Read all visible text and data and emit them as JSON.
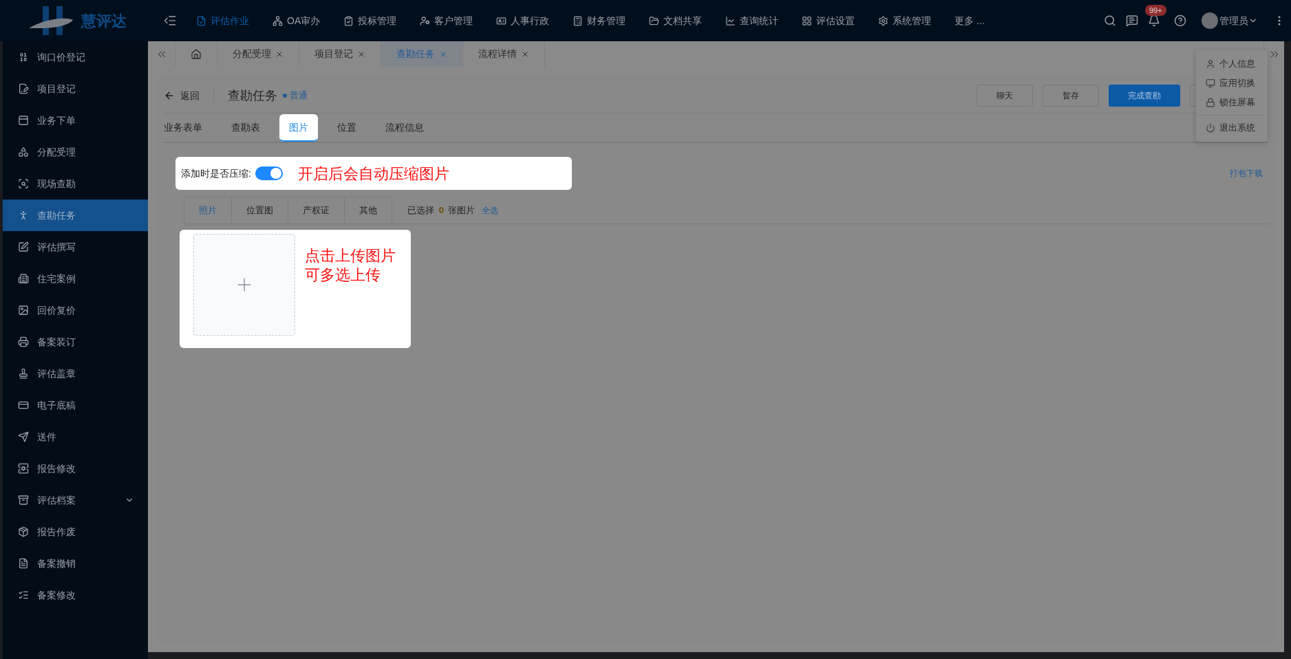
{
  "top_nav": {
    "logo": "慧评达",
    "menus": [
      {
        "label": "评估作业",
        "selected": true
      },
      {
        "label": "OA审办",
        "selected": false
      },
      {
        "label": "投标管理",
        "selected": false
      },
      {
        "label": "客户管理",
        "selected": false
      },
      {
        "label": "人事行政",
        "selected": false
      },
      {
        "label": "财务管理",
        "selected": false
      },
      {
        "label": "文档共享",
        "selected": false
      },
      {
        "label": "查询统计",
        "selected": false
      },
      {
        "label": "评估设置",
        "selected": false
      },
      {
        "label": "系统管理",
        "selected": false
      }
    ],
    "more": "更多 ...",
    "notification_badge": "99+",
    "user": "管理员"
  },
  "sidebar": {
    "items": [
      {
        "label": "询口价登记",
        "selected": false,
        "expandable": false
      },
      {
        "label": "项目登记",
        "selected": false,
        "expandable": false
      },
      {
        "label": "业务下单",
        "selected": false,
        "expandable": false
      },
      {
        "label": "分配受理",
        "selected": false,
        "expandable": false
      },
      {
        "label": "现场查勘",
        "selected": false,
        "expandable": false
      },
      {
        "label": "查勘任务",
        "selected": true,
        "expandable": false
      },
      {
        "label": "评估撰写",
        "selected": false,
        "expandable": false
      },
      {
        "label": "住宅案例",
        "selected": false,
        "expandable": false
      },
      {
        "label": "回价复价",
        "selected": false,
        "expandable": false
      },
      {
        "label": "备案装订",
        "selected": false,
        "expandable": false
      },
      {
        "label": "评估盖章",
        "selected": false,
        "expandable": false
      },
      {
        "label": "电子底稿",
        "selected": false,
        "expandable": false
      },
      {
        "label": "送件",
        "selected": false,
        "expandable": false
      },
      {
        "label": "报告修改",
        "selected": false,
        "expandable": false
      },
      {
        "label": "评估档案",
        "selected": false,
        "expandable": true
      },
      {
        "label": "报告作废",
        "selected": false,
        "expandable": false
      },
      {
        "label": "备案撤销",
        "selected": false,
        "expandable": false
      },
      {
        "label": "备案修改",
        "selected": false,
        "expandable": false
      }
    ]
  },
  "page_tabs": [
    {
      "kind": "home",
      "selected": false
    },
    {
      "kind": "page",
      "label": "分配受理",
      "selected": false
    },
    {
      "kind": "page",
      "label": "项目登记",
      "selected": false
    },
    {
      "kind": "page",
      "label": "查勘任务",
      "selected": true
    },
    {
      "kind": "page",
      "label": "流程详情",
      "selected": false
    }
  ],
  "page": {
    "back": "返回",
    "title": "查勘任务",
    "priority": "普通",
    "actions": [
      {
        "kind": "default",
        "label": "聊天"
      },
      {
        "kind": "default",
        "label": "暂存"
      },
      {
        "kind": "primary",
        "label": "完成查勘"
      }
    ]
  },
  "content_tabs": [
    {
      "label": "业务表单",
      "selected": false
    },
    {
      "label": "查勘表",
      "selected": false
    },
    {
      "label": "图片",
      "selected": true
    },
    {
      "label": "位置",
      "selected": false
    },
    {
      "label": "流程信息",
      "selected": false
    }
  ],
  "compress": {
    "label": "添加时是否压缩:",
    "on": true,
    "hint": "开启后会自动压缩图片"
  },
  "download_link": "打包下载",
  "photo_tabs": [
    {
      "label": "照片",
      "selected": true
    },
    {
      "label": "位置图",
      "selected": false
    },
    {
      "label": "产权证",
      "selected": false
    },
    {
      "label": "其他",
      "selected": false
    }
  ],
  "selection": {
    "prefix": "已选择",
    "count": "0",
    "suffix": "张图片",
    "select_all": "全选"
  },
  "upload": {
    "hint_lines": [
      "点击上传图片",
      "可多选上传"
    ]
  },
  "user_menu": {
    "items": [
      {
        "kind": "profile",
        "label": "个人信息"
      },
      {
        "kind": "switch",
        "label": "应用切换"
      },
      {
        "kind": "lock",
        "label": "锁住屏幕"
      },
      {
        "kind": "logout",
        "label": "退出系统"
      }
    ]
  }
}
